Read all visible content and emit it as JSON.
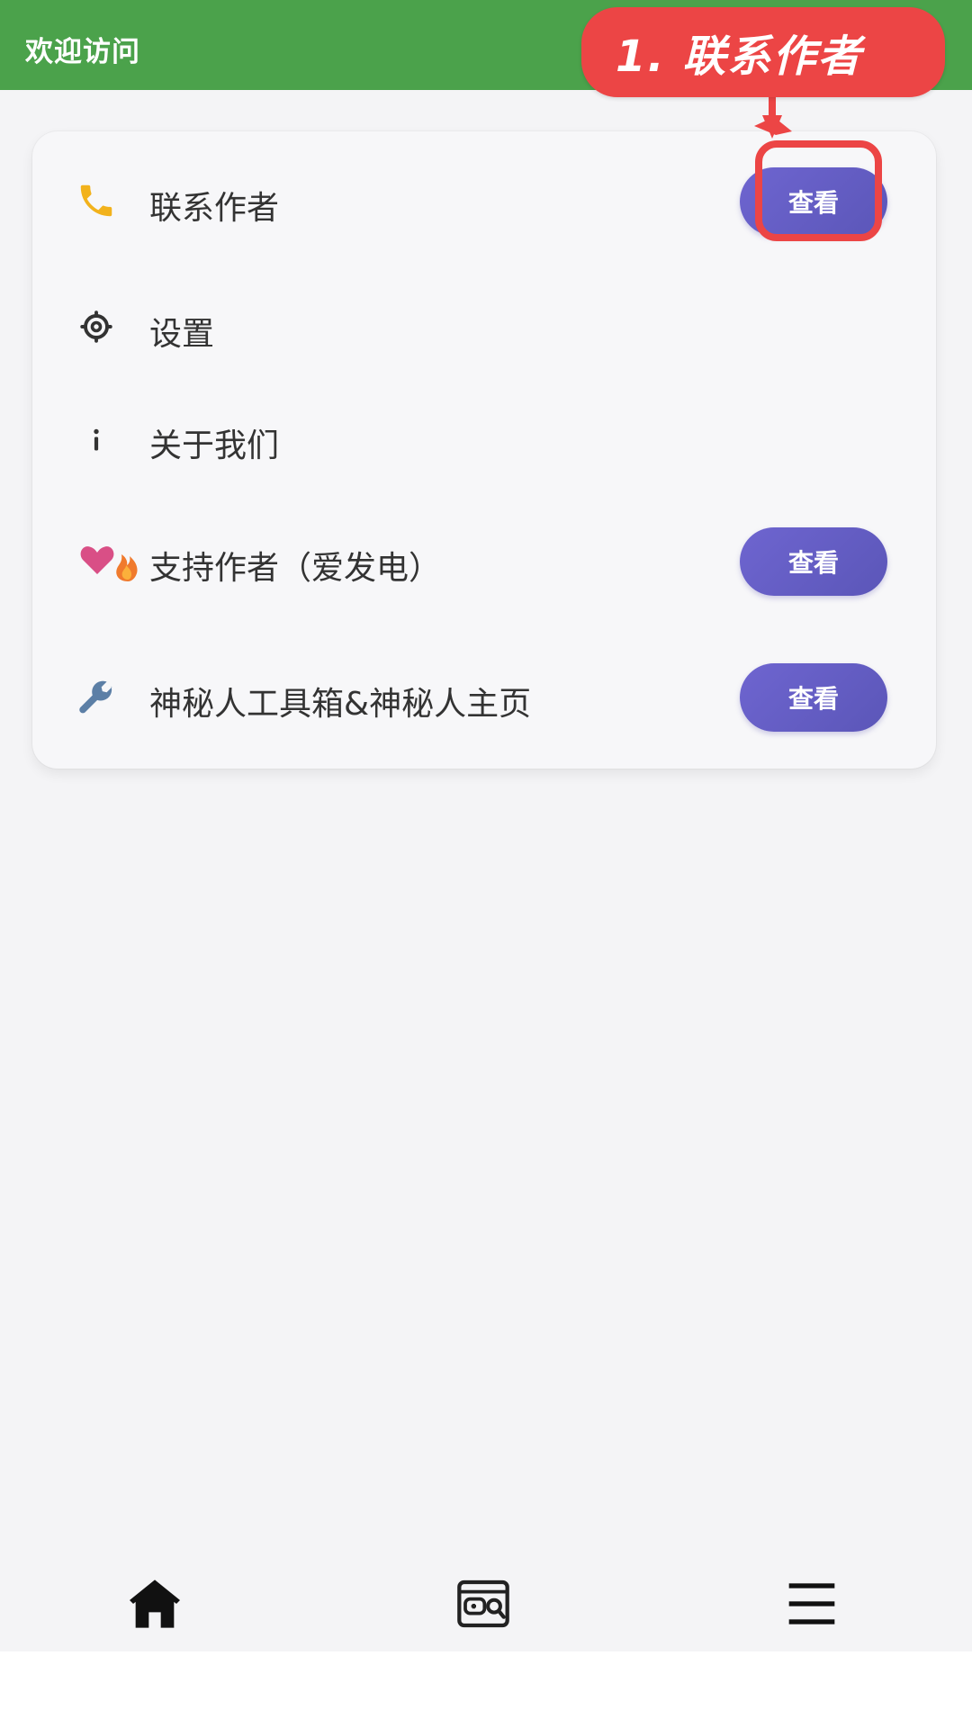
{
  "app_bar": {
    "title": "欢迎访问"
  },
  "annotation": {
    "callout_text": "1. 联系作者"
  },
  "menu": {
    "items": [
      {
        "icon": "phone-icon",
        "label": "联系作者",
        "button": "查看"
      },
      {
        "icon": "gear-icon",
        "label": "设置"
      },
      {
        "icon": "info-icon",
        "label": "关于我们"
      },
      {
        "icon": "heart-fire-icon",
        "label": "支持作者（爱发电）",
        "button": "查看"
      },
      {
        "icon": "wrench-icon",
        "label": "神秘人工具箱&神秘人主页",
        "button": "查看"
      }
    ]
  },
  "bottom_nav": {
    "items": [
      {
        "icon": "home-icon"
      },
      {
        "icon": "game-search-icon"
      },
      {
        "icon": "menu-icon"
      }
    ]
  },
  "colors": {
    "app_bar": "#4ba24b",
    "button": "#6e65d0",
    "annotation": "#ec4545",
    "background": "#f4f4f6"
  }
}
